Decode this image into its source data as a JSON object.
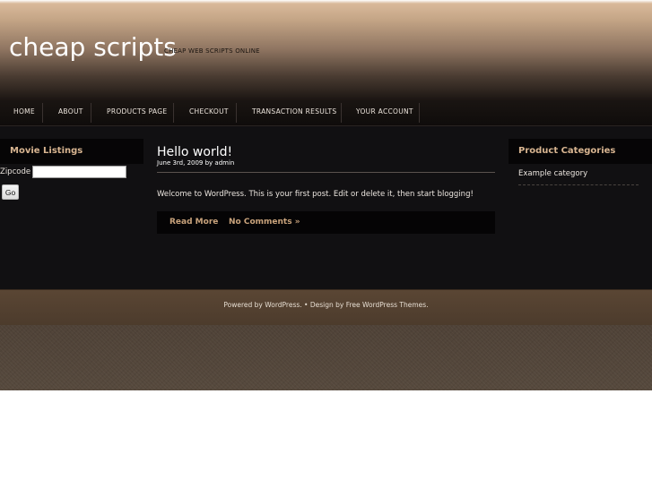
{
  "header": {
    "site_title": "cheap scripts",
    "tagline": "CHEAP WEB SCRIPTS ONLINE"
  },
  "nav": {
    "items": [
      {
        "label": "HOME"
      },
      {
        "label": "ABOUT"
      },
      {
        "label": "PRODUCTS PAGE"
      },
      {
        "label": "CHECKOUT"
      },
      {
        "label": "TRANSACTION RESULTS"
      },
      {
        "label": "YOUR ACCOUNT"
      }
    ]
  },
  "left_sidebar": {
    "widget_title": "Movie Listings",
    "zipcode_label": "Zipcode",
    "zipcode_value": "",
    "go_label": "Go"
  },
  "post": {
    "title": "Hello world!",
    "meta": "June 3rd, 2009 by admin",
    "body": "Welcome to WordPress. This is your first post. Edit or delete it, then start blogging!",
    "read_more": "Read More",
    "comments": "No Comments »"
  },
  "right_sidebar": {
    "title": "Product Categories",
    "categories": [
      "Example category"
    ]
  },
  "footer": {
    "text": "Powered by WordPress.  •  Design by Free WordPress Themes."
  },
  "colors": {
    "accent": "#d8b591",
    "link": "#c9a37c",
    "background": "#111012",
    "footer_band": "#5a4634"
  }
}
